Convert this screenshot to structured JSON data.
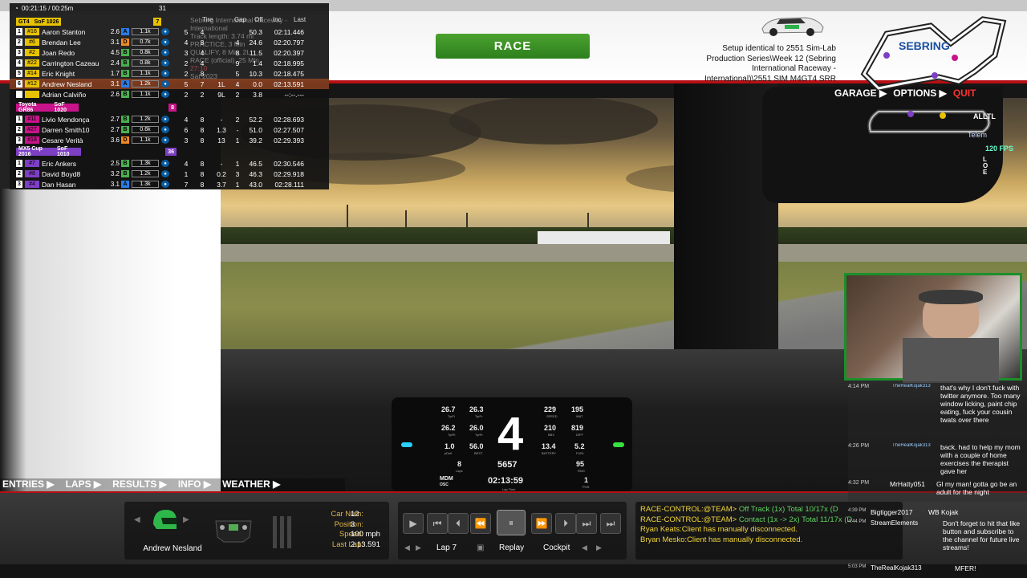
{
  "header": {
    "race_label": "RACE",
    "setup_text": "Setup identical to 2551 Sim-Lab Production Series\\Week 12 (Sebring International Raceway - International)\\2551 SIM M4GT4 SRR"
  },
  "nav": {
    "garage": "GARAGE ▶",
    "options": "OPTIONS ▶",
    "quit": "QUIT"
  },
  "hud": {
    "fps": "120 FPS",
    "telemetry": "Telem",
    "alltime": "ALLTL",
    "loe": "L\nO\nE"
  },
  "session": {
    "clock": "00:21:15 / 00:25m",
    "count": "31",
    "left_text": "Sebring International Raceway - International",
    "track_length": "Track length: 3.74 mi",
    "practice": "PRACTICE, 3 Min",
    "qualify": "QUALIFY, 8 Min, 2L",
    "race": "RACE (official), 25 Min",
    "elapsed": "27:10",
    "timestamp": "Sat 2023",
    "col_tire": "Tire",
    "col_gap": "Gap",
    "col_off": "Off",
    "col_inc": "Inc",
    "col_last": "Last"
  },
  "class_headers": [
    {
      "class": "GT4",
      "sof": "SoF 1026",
      "count": "7",
      "color": "#e7c200"
    },
    {
      "class": "Toyota GR86",
      "sof": "SoF 1020",
      "count": "8",
      "color": "#c8148a"
    },
    {
      "class": "MX5 Cup 2016",
      "sof": "SoF 1010",
      "count": "36",
      "color": "#7d3fc4"
    }
  ],
  "drivers": [
    {
      "pos": "1",
      "num": "#16",
      "name": "Aaron Stanton",
      "irating": "2.6",
      "lic": "A",
      "sr": "1.1k",
      "lap": "5",
      "gap": "4",
      "off": "",
      "inc": "",
      "last": "02:11.446",
      "pct": "50.3"
    },
    {
      "pos": "2",
      "num": "#6",
      "name": "Brendan Lee",
      "irating": "3.1",
      "lic": "D",
      "sr": "0.7k",
      "lap": "4",
      "gap": "8",
      "off": "",
      "inc": "4",
      "last": "02:20.797",
      "pct": "24.6"
    },
    {
      "pos": "3",
      "num": "#2",
      "name": "Joan Redo",
      "irating": "4.5",
      "lic": "B",
      "sr": "0.8k",
      "lap": "3",
      "gap": "4",
      "off": "",
      "inc": "8",
      "last": "02:20.397",
      "pct": "11.5"
    },
    {
      "pos": "4",
      "num": "#22",
      "name": "Carrington Cazeau",
      "irating": "2.4",
      "lic": "B",
      "sr": "0.8k",
      "lap": "2",
      "gap": "4",
      "off": "",
      "inc": "9",
      "last": "02:18.995",
      "pct": "1.4"
    },
    {
      "pos": "5",
      "num": "#14",
      "name": "Eric Knight",
      "irating": "1.7",
      "lic": "B",
      "sr": "1.1k",
      "lap": "2",
      "gap": "8",
      "off": "",
      "inc": "5",
      "last": "02:18.475",
      "pct": "10.3"
    },
    {
      "pos": "6",
      "num": "#12",
      "name": "Andrew Nesland",
      "irating": "3.1",
      "lic": "A",
      "sr": "1.2k",
      "lap": "5",
      "gap": "7",
      "off": "1L",
      "inc": "4",
      "last": "02:13.591",
      "pct": "0.0"
    },
    {
      "pos": "",
      "num": "",
      "name": "Adrian Calviño",
      "irating": "2.6",
      "lic": "B",
      "sr": "1.1k",
      "lap": "2",
      "gap": "2",
      "off": "9L",
      "inc": "2",
      "last": "--:--.---",
      "pct": "3.8"
    },
    {
      "pos": "1",
      "num": "#11",
      "name": "Livio Mendonça",
      "irating": "2.7",
      "lic": "B",
      "sr": "1.2k",
      "lap": "4",
      "gap": "8",
      "off": "-",
      "inc": "2",
      "last": "02:28.693",
      "pct": "52.2"
    },
    {
      "pos": "2",
      "num": "#27",
      "name": "Darren Smith10",
      "irating": "2.7",
      "lic": "B",
      "sr": "0.6k",
      "lap": "6",
      "gap": "8",
      "off": "1.3",
      "inc": "-",
      "last": "02:27.507",
      "pct": "51.0"
    },
    {
      "pos": "3",
      "num": "#18",
      "name": "Cesare Verità",
      "irating": "3.6",
      "lic": "D",
      "sr": "1.1k",
      "lap": "3",
      "gap": "8",
      "off": "13",
      "inc": "1",
      "last": "02:29.393",
      "pct": "39.2"
    },
    {
      "pos": "1",
      "num": "#7",
      "name": "Eric Ankers",
      "irating": "2.5",
      "lic": "B",
      "sr": "1.3k",
      "lap": "4",
      "gap": "8",
      "off": "-",
      "inc": "1",
      "last": "02:30.546",
      "pct": "46.5"
    },
    {
      "pos": "2",
      "num": "#8",
      "name": "David Boyd8",
      "irating": "3.2",
      "lic": "B",
      "sr": "1.2k",
      "lap": "1",
      "gap": "8",
      "off": "0.2",
      "inc": "3",
      "last": "02:29.918",
      "pct": "46.3"
    },
    {
      "pos": "3",
      "num": "#4",
      "name": "Dan Hasan",
      "irating": "3.1",
      "lic": "A",
      "sr": "1.3k",
      "lap": "7",
      "gap": "8",
      "off": "3.7",
      "inc": "1",
      "last": "02:28.111",
      "pct": "43.0"
    }
  ],
  "bottom_nav": {
    "entries": "ENTRIES ▶",
    "laps": "LAPS ▶",
    "results": "RESULTS ▶",
    "info": "INFO ▶",
    "weather": "WEATHER ▶"
  },
  "driver_panel": {
    "name": "Andrew Nesland",
    "car_num_label": "Car Num:",
    "car_num": "12",
    "position_label": "Position:",
    "position": "3",
    "speed_label": "Speed:",
    "speed": "100 mph",
    "last_lap_label": "Last Lap:",
    "last_lap": "2:13.591"
  },
  "controls": {
    "lap": "Lap 7",
    "replay": "Replay",
    "cockpit": "Cockpit"
  },
  "messages": [
    {
      "from": "RACE-CONTROL:@TEAM>",
      "text": "Off Track (1x) Total 10/17x (D"
    },
    {
      "from": "RACE-CONTROL:@TEAM>",
      "text": "Contact (1x -> 2x) Total 11/17x (D"
    },
    {
      "from": "",
      "text": "Ryan Keats:Client has manually disconnected."
    },
    {
      "from": "",
      "text": "Bryan Mesko:Client has manually disconnected."
    }
  ],
  "dash": {
    "gear": "4",
    "rpm": "5657",
    "time": "02:13:59",
    "lap": "8",
    "v1": "26.7",
    "v2": "26.3",
    "v3": "26.2",
    "v4": "26.0",
    "v5": "1.0",
    "v6": "56.0",
    "v7": "229",
    "v8": "195",
    "v9": "210",
    "v10": "819",
    "v11": "13.4",
    "v12": "5.2",
    "v13": "95",
    "v14": "1",
    "l_tyrefl": "TyrFl",
    "l_tyrefr": "TyrFr",
    "l_tyrerl": "TyrRl",
    "l_tyrerr": "TyrRr",
    "l_pdelt": "pDelt",
    "l_best": "BEST",
    "l_speed": "SPEED",
    "l_water": "WAT",
    "l_brake": "BBX",
    "l_diff": "DIFF",
    "l_battery": "BATTERY",
    "l_fuel": "FUEL",
    "l_laps": "Laps",
    "l_mdm": "MDM",
    "l_osc": "OSC",
    "l_laptime": "Lap Time",
    "l_pos": "POS",
    "l_rng": "RNG"
  },
  "chat": [
    {
      "time": "4:14 PM",
      "user": "TheRealKojak313",
      "text": "that's why I don't fuck with twitter anymore. Too many window licking, paint chip eating, fuck your cousin twats over there"
    },
    {
      "time": "4:26 PM",
      "user": "TheRealKojak313",
      "text": "back. had to help my mom with a couple of home exercises the therapist gave her"
    },
    {
      "time": "4:32 PM",
      "user": "MrHatty051",
      "text": "Gl my man! gotta go be an adult for the night"
    },
    {
      "time": "4:39 PM",
      "user": "Bigtigger2017",
      "text": "WB Kojak"
    },
    {
      "time": "4:44 PM",
      "user": "StreamElements",
      "text": "Don't forget to hit that like button and subscribe to the channel for future live streams!"
    },
    {
      "time": "5:03 PM",
      "user": "TheRealKojak313",
      "text": "MFER!"
    }
  ],
  "colors": {
    "accent_red": "#b70f14",
    "race_green": "#3d9a28",
    "gt4_yellow": "#e7c200",
    "toyota_pink": "#c8148a",
    "mx5_purple": "#7d3fc4",
    "message_yellow": "#f3d63a"
  },
  "icons": {
    "helmet": "helmet-icon",
    "wheel": "steering-wheel-icon",
    "play": "play-icon",
    "pause": "pause-icon"
  }
}
